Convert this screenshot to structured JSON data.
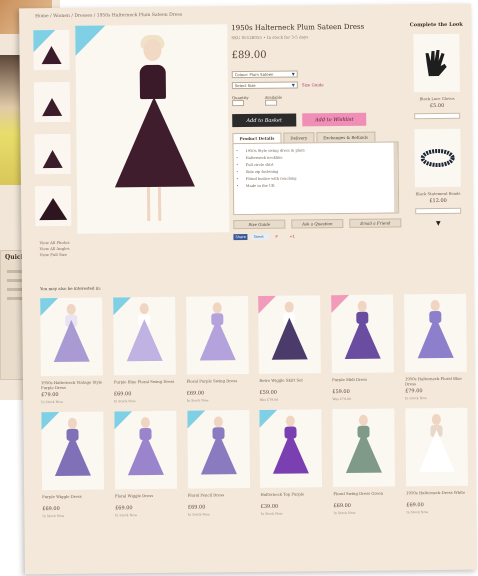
{
  "background": {
    "panel_title": "Quick"
  },
  "breadcrumb": "Home / Women / Dresses / 1950s Halterneck Plum Sateen Dress",
  "product": {
    "title": "1950s Halterneck Plum Sateen Dress",
    "subtitle": "SKU 05128055 • In stock for 3-5 days",
    "price": "£89.00",
    "colour_select": "Colour: Plum Sateen",
    "size_select": "Select Size",
    "size_guide": "Size Guide",
    "qty_label": "Quantity",
    "avail_label": "Available",
    "add_basket": "Add to Basket",
    "add_wishlist": "Add to Wishlist",
    "tabs": [
      "Product Details",
      "Delivery",
      "Exchanges & Refunds"
    ],
    "details": [
      "1950s Style swing dress in plum",
      "Halterneck neckline",
      "Full circle skirt",
      "Side zip fastening",
      "Fitted bodice with rouching",
      "Made in the UK"
    ],
    "link_buttons": [
      "Size Guide",
      "Ask a Question",
      "Email a Friend"
    ],
    "social": [
      "Share",
      "Tweet",
      "P",
      "+1"
    ],
    "thumb_links": [
      "View All Photos",
      "View All Angles",
      "View Full Size"
    ]
  },
  "complete_look": {
    "title": "Complete the Look",
    "items": [
      {
        "name": "Black Lace Gloves",
        "price": "£5.00"
      },
      {
        "name": "Black Statement Beads",
        "price": "£12.00"
      }
    ]
  },
  "also_like": "You may also be interested in:",
  "products": [
    {
      "name": "1950s Halterneck Vintage Style Purple Dress",
      "price": "£79.00",
      "meta": "In Stock Now",
      "tag": "blue",
      "dress": "#a99ad4",
      "top": "#e9e3f2"
    },
    {
      "name": "Purple Blue Floral Swing Dress",
      "price": "£69.00",
      "meta": "In Stock Now",
      "tag": "blue",
      "dress": "#c0b2e2",
      "top": "#ffffff"
    },
    {
      "name": "Floral Purple Swing Dress",
      "price": "£69.00",
      "meta": "In Stock Now",
      "tag": "none",
      "dress": "#b3a2dc",
      "top": "#b3a2dc"
    },
    {
      "name": "Retro Wiggle Skirt Set",
      "price": "£59.00",
      "meta": "Was £79.00",
      "tag": "pink",
      "dress": "#4a3b6a",
      "top": "#ffffff"
    },
    {
      "name": "Purple Midi Dress",
      "price": "£59.00",
      "meta": "Was £79.00",
      "tag": "pink",
      "dress": "#6a4ca0",
      "top": "#6a4ca0"
    },
    {
      "name": "1950s Halterneck Floral Blue Dress",
      "price": "£79.00",
      "meta": "In Stock Now",
      "tag": "none",
      "dress": "#8e7fcc",
      "top": "#8e7fcc"
    },
    {
      "name": "Purple Wiggle Dress",
      "price": "£69.00",
      "meta": "In Stock Now",
      "tag": "blue",
      "dress": "#8070b8",
      "top": "#8070b8"
    },
    {
      "name": "Floral Wiggle Dress",
      "price": "£69.00",
      "meta": "In Stock Now",
      "tag": "blue",
      "dress": "#9a84cc",
      "top": "#9a84cc"
    },
    {
      "name": "Floral Pencil Dress",
      "price": "£69.00",
      "meta": "In Stock Now",
      "tag": "blue",
      "dress": "#8a7ac0",
      "top": "#8a7ac0"
    },
    {
      "name": "Halterneck Top Purple",
      "price": "£39.00",
      "meta": "In Stock Now",
      "tag": "blue",
      "dress": "#7a3fb0",
      "top": "#7a3fb0"
    },
    {
      "name": "Floral Swing Dress Green",
      "price": "£69.00",
      "meta": "In Stock Now",
      "tag": "none",
      "dress": "#7f9a88",
      "top": "#7f9a88"
    },
    {
      "name": "1950s Halterneck Dress White",
      "price": "£69.00",
      "meta": "In Stock Now",
      "tag": "none",
      "dress": "#ffffff",
      "top": "#e8d8c8"
    }
  ]
}
